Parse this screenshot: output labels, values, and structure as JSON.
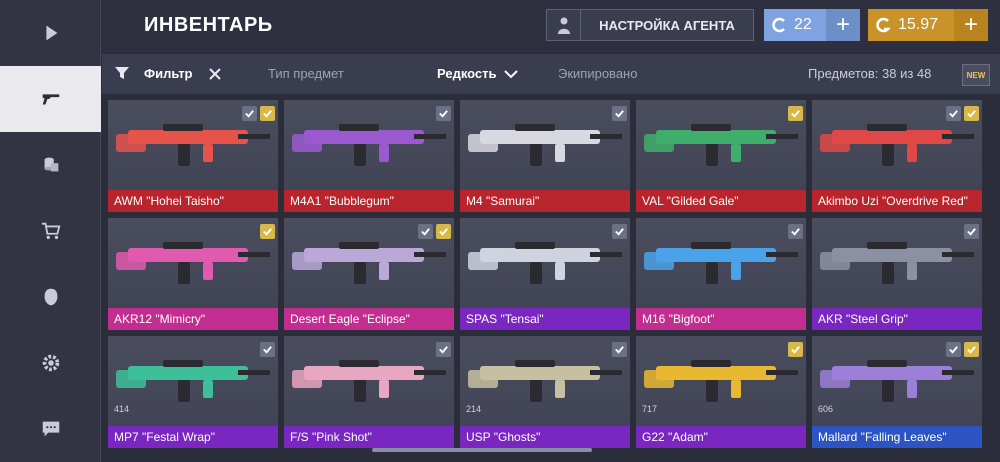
{
  "header": {
    "title": "ИНВЕНТАРЬ",
    "agent_button": "НАСТРОЙКА АГЕНТА",
    "currency_silver": "22",
    "currency_gold": "15.97",
    "plus": "+"
  },
  "filterbar": {
    "filter_label": "Фильтр",
    "type_label": "Тип предмет",
    "rarity_label": "Редкость",
    "equipped_label": "Экипировано",
    "count_label": "Предметов: 38 из 48",
    "new_tag": "NEW"
  },
  "sidebar": {
    "items": [
      "play-icon",
      "gun-icon",
      "coins-icon",
      "cart-icon",
      "mask-icon",
      "settings-icon",
      "chat-icon"
    ]
  },
  "items": [
    {
      "name": "AWM \"Hohei Taisho\"",
      "color": "#b8252c",
      "chk": "wg",
      "badge": ""
    },
    {
      "name": "M4A1 \"Bubblegum\"",
      "color": "#b8252c",
      "chk": "w",
      "badge": ""
    },
    {
      "name": "M4 \"Samurai\"",
      "color": "#b8252c",
      "chk": "w",
      "badge": ""
    },
    {
      "name": "VAL \"Gilded Gale\"",
      "color": "#b8252c",
      "chk": "g",
      "badge": ""
    },
    {
      "name": "Akimbo Uzi \"Overdrive Red\"",
      "color": "#b8252c",
      "chk": "wg",
      "badge": ""
    },
    {
      "name": "AKR12 \"Mimicry\"",
      "color": "#c22e8f",
      "chk": "g",
      "badge": ""
    },
    {
      "name": "Desert Eagle \"Eclipse\"",
      "color": "#c22e8f",
      "chk": "wg",
      "badge": ""
    },
    {
      "name": "SPAS \"Tensai\"",
      "color": "#7a26c0",
      "chk": "w",
      "badge": ""
    },
    {
      "name": "M16 \"Bigfoot\"",
      "color": "#c22e8f",
      "chk": "w",
      "badge": ""
    },
    {
      "name": "AKR \"Steel Grip\"",
      "color": "#7a26c0",
      "chk": "w",
      "badge": ""
    },
    {
      "name": "MP7 \"Festal Wrap\"",
      "color": "#7a26c0",
      "chk": "w",
      "badge": "414"
    },
    {
      "name": "F/S \"Pink Shot\"",
      "color": "#7a26c0",
      "chk": "w",
      "badge": ""
    },
    {
      "name": "USP \"Ghosts\"",
      "color": "#7a26c0",
      "chk": "w",
      "badge": "214"
    },
    {
      "name": "G22 \"Adam\"",
      "color": "#7a26c0",
      "chk": "g",
      "badge": "717"
    },
    {
      "name": "Mallard \"Falling Leaves\"",
      "color": "#2c54c2",
      "chk": "wg",
      "badge": "606"
    }
  ]
}
